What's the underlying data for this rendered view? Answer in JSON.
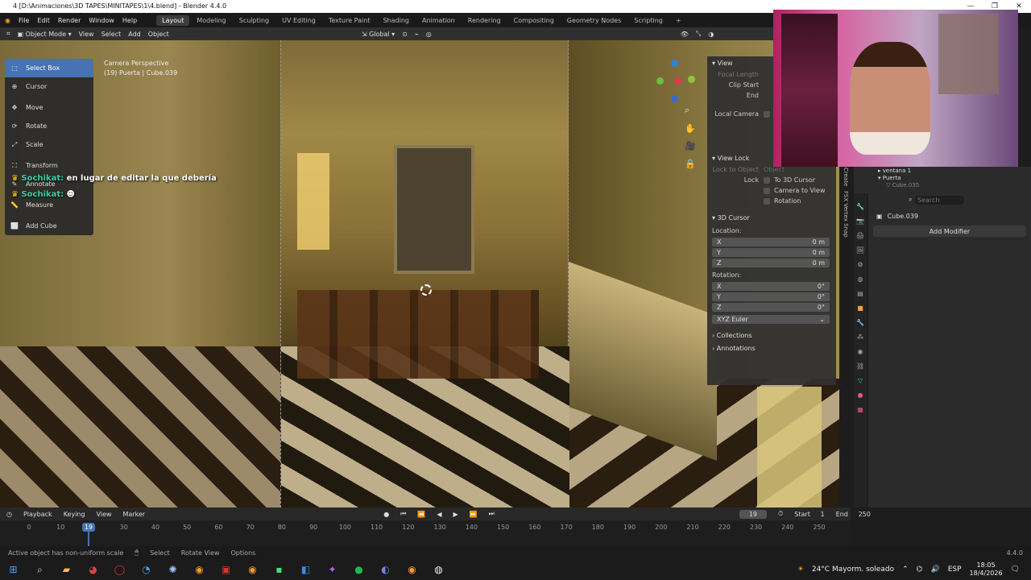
{
  "window": {
    "title": "4 [D:\\Animaciones\\3D TAPES\\MINITAPES\\1\\4.blend] - Blender 4.4.0",
    "minimize": "—",
    "maximize": "❐",
    "close": "✕"
  },
  "menu": [
    "File",
    "Edit",
    "Render",
    "Window",
    "Help"
  ],
  "workspaces": [
    {
      "label": "Layout",
      "active": true
    },
    {
      "label": "Modeling"
    },
    {
      "label": "Sculpting"
    },
    {
      "label": "UV Editing"
    },
    {
      "label": "Texture Paint"
    },
    {
      "label": "Shading"
    },
    {
      "label": "Animation"
    },
    {
      "label": "Rendering"
    },
    {
      "label": "Compositing"
    },
    {
      "label": "Geometry Nodes"
    },
    {
      "label": "Scripting"
    },
    {
      "label": "+"
    }
  ],
  "header": {
    "mode": "Object Mode",
    "menus": [
      "View",
      "Select",
      "Add",
      "Object"
    ],
    "orientation": "Global"
  },
  "viewport": {
    "perspective": "Camera Perspective",
    "object": "(19) Puerta | Cube.039"
  },
  "tools": [
    {
      "label": "Select Box",
      "icon": "select-box-icon",
      "glyph": "⬚",
      "active": true
    },
    {
      "label": "Cursor",
      "icon": "cursor-icon",
      "glyph": "⊕"
    },
    {
      "label": "Move",
      "icon": "move-icon",
      "glyph": "✥"
    },
    {
      "label": "Rotate",
      "icon": "rotate-icon",
      "glyph": "⟳"
    },
    {
      "label": "Scale",
      "icon": "scale-icon",
      "glyph": "⤢"
    },
    {
      "label": "Transform",
      "icon": "transform-icon",
      "glyph": "⛶"
    },
    {
      "label": "Annotate",
      "icon": "annotate-icon",
      "glyph": "✎"
    },
    {
      "label": "Measure",
      "icon": "measure-icon",
      "glyph": "📏"
    },
    {
      "label": "Add Cube",
      "icon": "add-cube-icon",
      "glyph": "⬜"
    }
  ],
  "chat": [
    {
      "user": "Sochikat:",
      "msg": "en lugar de editar la que debería"
    },
    {
      "user": "Sochikat:",
      "msg": ""
    }
  ],
  "npanel": {
    "view": {
      "title": "View",
      "focal": "Focal Length",
      "clip_start": "Clip Start",
      "end": "End",
      "local_camera": "Local Camera"
    },
    "view_lock": {
      "title": "View Lock",
      "lock_to_object": "Lock to Object",
      "object_ph": "Object",
      "lock": "Lock",
      "to_cursor": "To 3D Cursor",
      "cam_to_view": "Camera to View",
      "rotation": "Rotation"
    },
    "cursor": {
      "title": "3D Cursor",
      "location": "Location:",
      "rotation": "Rotation:",
      "loc": [
        {
          "axis": "X",
          "val": "0 m"
        },
        {
          "axis": "Y",
          "val": "0 m"
        },
        {
          "axis": "Z",
          "val": "0 m"
        }
      ],
      "rot": [
        {
          "axis": "X",
          "val": "0°"
        },
        {
          "axis": "Y",
          "val": "0°"
        },
        {
          "axis": "Z",
          "val": "0°"
        }
      ],
      "mode": "XYZ Euler"
    },
    "collections": "Collections",
    "annotations": "Annotations"
  },
  "sidetabs": [
    "Create",
    "FSX Vertex Snap"
  ],
  "outliner": {
    "items": [
      "ventana 1",
      "Puerta",
      "Cube.035"
    ]
  },
  "properties": {
    "object": "Cube.039",
    "search_ph": "Search",
    "add_modifier": "Add Modifier"
  },
  "timeline": {
    "menus": [
      "Playback",
      "Keying",
      "View",
      "Marker"
    ],
    "frame": "19",
    "start_label": "Start",
    "start": "1",
    "end_label": "End",
    "end": "250",
    "ticks": [
      "0",
      "10",
      "19",
      "30",
      "40",
      "50",
      "60",
      "70",
      "80",
      "90",
      "100",
      "110",
      "120",
      "130",
      "140",
      "150",
      "160",
      "170",
      "180",
      "190",
      "200",
      "210",
      "220",
      "230",
      "240",
      "250"
    ]
  },
  "status": {
    "msg": "Active object has non-uniform scale",
    "select": "Select",
    "rotate": "Rotate View",
    "options": "Options",
    "version": "4.4.0"
  },
  "taskbar": {
    "weather": "24°C  Mayorm. soleado",
    "lang": "ESP",
    "time": "18:05",
    "date": "18/4/2026",
    "apps": [
      "windows-start-icon",
      "search-icon",
      "file-explorer-icon",
      "chrome-icon",
      "opera-icon",
      "edge-icon",
      "app-icon",
      "blender-icon",
      "video-app-icon",
      "blender-icon-2",
      "pycharm-icon",
      "vscode-icon",
      "app-icon-2",
      "spotify-icon",
      "discord-icon",
      "blender-icon-3",
      "obs-icon"
    ]
  },
  "colors": {
    "accent": "#4772b3",
    "active_ws": "#3c3c3c",
    "chat_user": "#35d0a5"
  }
}
